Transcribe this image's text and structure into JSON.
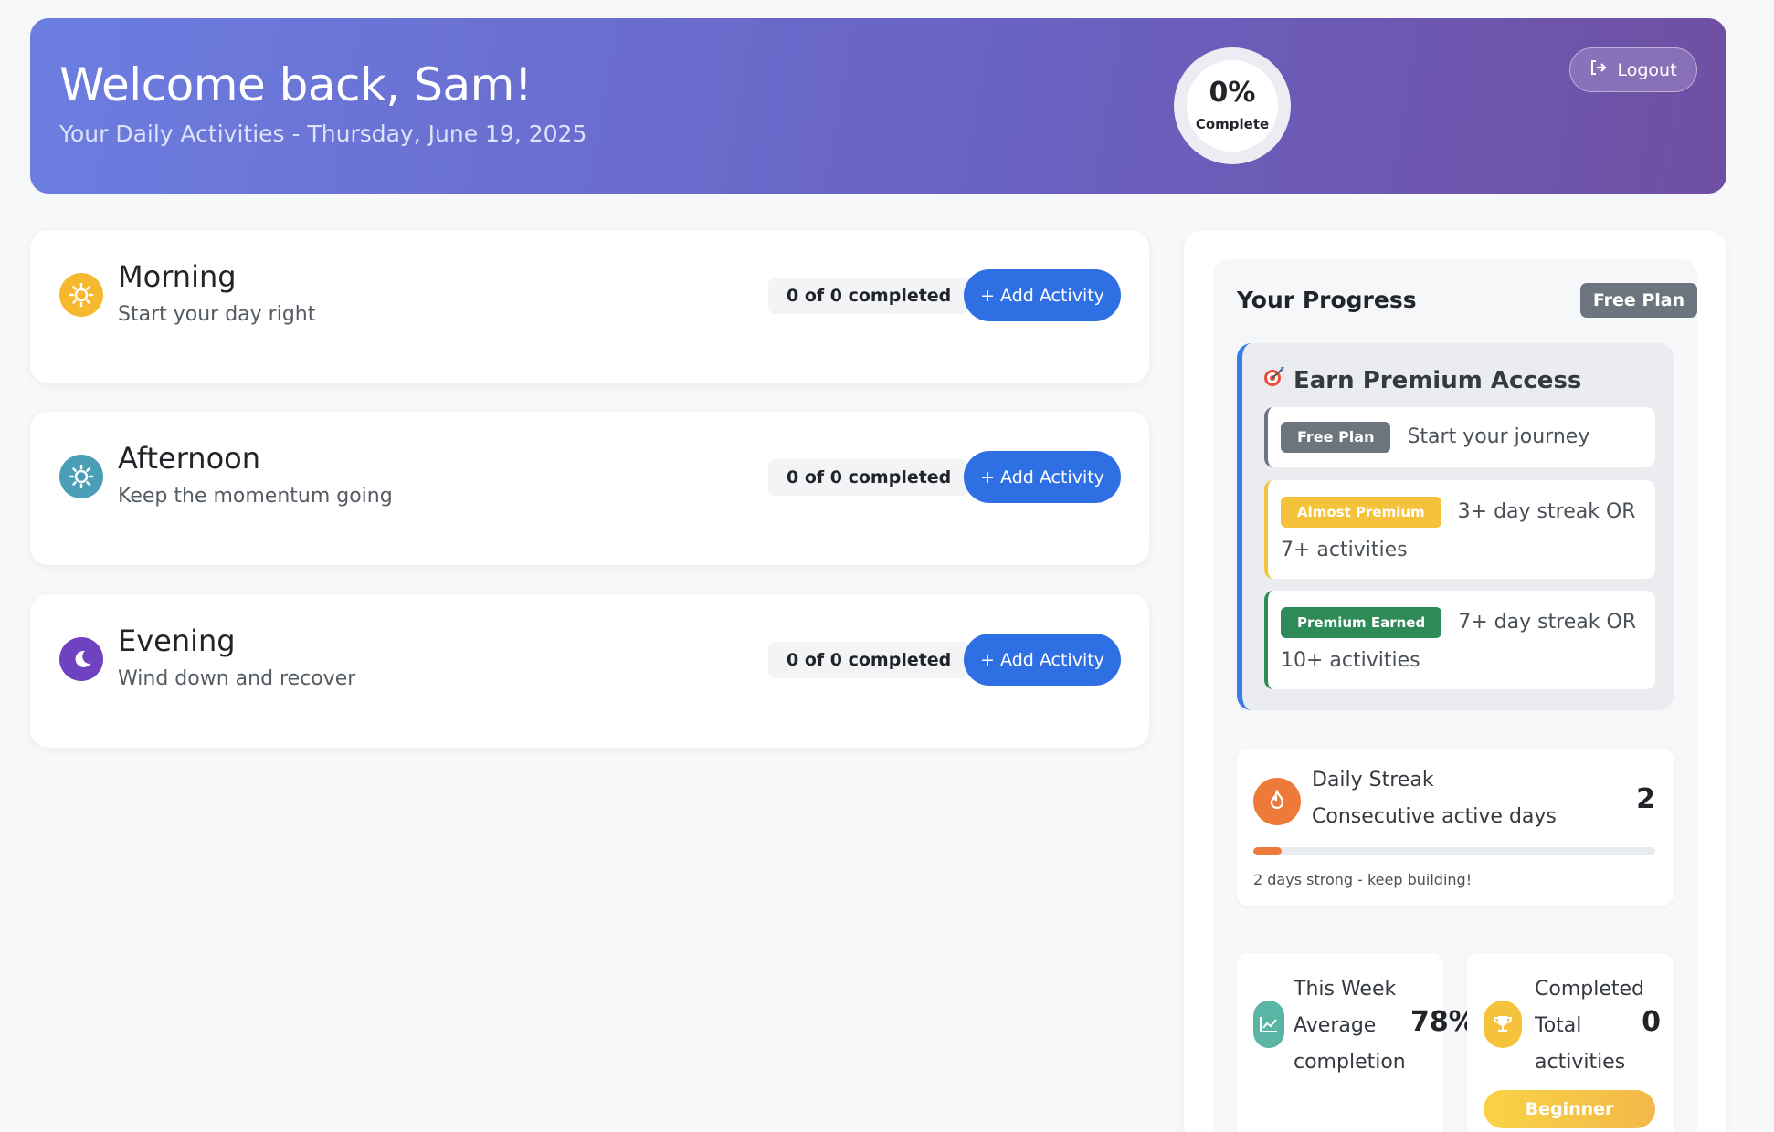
{
  "header": {
    "title": "Welcome back, Sam!",
    "subtitle": "Your Daily Activities - Thursday, June 19, 2025",
    "progress_percent": "0%",
    "progress_label": "Complete",
    "logout_label": "Logout"
  },
  "periods": [
    {
      "name": "Morning",
      "description": "Start your day right",
      "count": "0 of 0 completed",
      "add_label": "+ Add Activity",
      "icon": "sun-icon",
      "color": "#f5b82e"
    },
    {
      "name": "Afternoon",
      "description": "Keep the momentum going",
      "count": "0 of 0 completed",
      "add_label": "+ Add Activity",
      "icon": "sun-icon",
      "color": "#4a9eb5"
    },
    {
      "name": "Evening",
      "description": "Wind down and recover",
      "count": "0 of 0 completed",
      "add_label": "+ Add Activity",
      "icon": "moon-icon",
      "color": "#6f42c1"
    }
  ],
  "progress": {
    "title": "Your Progress",
    "plan_badge": "Free Plan",
    "earn": {
      "title": "Earn Premium Access",
      "icon": "target-icon",
      "tiers": [
        {
          "badge": "Free Plan",
          "text": "Start your journey",
          "color": "#6c757d"
        },
        {
          "badge": "Almost Premium",
          "text_line1": "3+ day streak OR",
          "text_line2": "7+ activities",
          "color": "#f5c33b"
        },
        {
          "badge": "Premium Earned",
          "text_line1": "7+ day streak OR",
          "text_line2": "10+ activities",
          "color": "#2e8b57"
        }
      ]
    },
    "streak": {
      "label": "Daily Streak",
      "sublabel": "Consecutive active days",
      "value": "2",
      "progress_fraction": 0.07,
      "note": "2 days strong - keep building!",
      "icon": "fire-icon",
      "color": "#ee7a3a"
    },
    "week": {
      "line1": "This Week",
      "line2": "Average",
      "line3": "completion",
      "value": "78%",
      "icon": "chart-line-icon",
      "color": "#5bb5a5"
    },
    "completed": {
      "line1": "Completed",
      "line2": "Total",
      "line3": "activities",
      "value": "0",
      "level": "Beginner",
      "icon": "trophy-icon",
      "color": "#f5c33b"
    }
  }
}
